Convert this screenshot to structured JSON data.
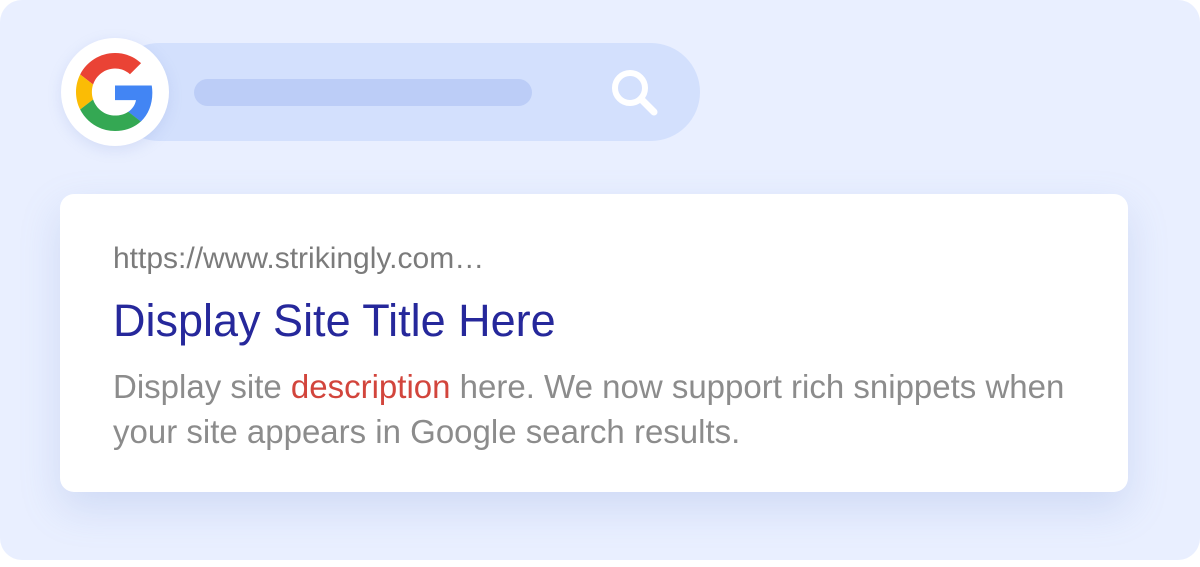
{
  "search_bar": {
    "logo_icon": "google-g-logo",
    "search_icon": "magnifier-icon",
    "colors": {
      "pill": "#d3e0fd",
      "placeholder_bar": "#bccdf7",
      "icon": "#ffffff"
    }
  },
  "result": {
    "url": "https://www.strikingly.com…",
    "title": "Display Site Title Here",
    "description": {
      "before": "Display site ",
      "highlight": "description",
      "after": " here. We now support rich snippets when your site appears in Google search results."
    },
    "colors": {
      "url": "#7b7b7b",
      "title": "#26289b",
      "description": "#8c8c8c",
      "highlight": "#d2453c"
    }
  },
  "background_color": "#e9efff"
}
